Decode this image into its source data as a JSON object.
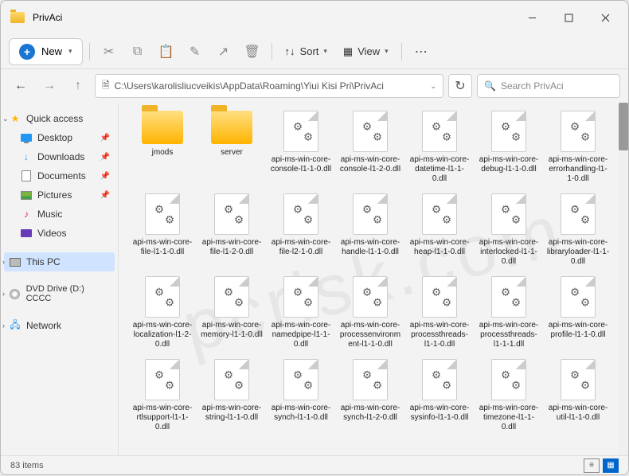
{
  "title": "PrivAci",
  "toolbar": {
    "new": "New",
    "sort": "Sort",
    "view": "View"
  },
  "address": "C:\\Users\\karolisliucveikis\\AppData\\Roaming\\Yiui Kisi Pri\\PrivAci",
  "search_placeholder": "Search PrivAci",
  "sidebar": {
    "quick": "Quick access",
    "desktop": "Desktop",
    "downloads": "Downloads",
    "documents": "Documents",
    "pictures": "Pictures",
    "music": "Music",
    "videos": "Videos",
    "thispc": "This PC",
    "dvd": "DVD Drive (D:) CCCC",
    "network": "Network"
  },
  "folders": [
    "jmods",
    "server"
  ],
  "files": [
    "api-ms-win-core-console-l1-1-0.dll",
    "api-ms-win-core-console-l1-2-0.dll",
    "api-ms-win-core-datetime-l1-1-0.dll",
    "api-ms-win-core-debug-l1-1-0.dll",
    "api-ms-win-core-errorhandling-l1-1-0.dll",
    "api-ms-win-core-file-l1-1-0.dll",
    "api-ms-win-core-file-l1-2-0.dll",
    "api-ms-win-core-file-l2-1-0.dll",
    "api-ms-win-core-handle-l1-1-0.dll",
    "api-ms-win-core-heap-l1-1-0.dll",
    "api-ms-win-core-interlocked-l1-1-0.dll",
    "api-ms-win-core-libraryloader-l1-1-0.dll",
    "api-ms-win-core-localization-l1-2-0.dll",
    "api-ms-win-core-memory-l1-1-0.dll",
    "api-ms-win-core-namedpipe-l1-1-0.dll",
    "api-ms-win-core-processenvironment-l1-1-0.dll",
    "api-ms-win-core-processthreads-l1-1-0.dll",
    "api-ms-win-core-processthreads-l1-1-1.dll",
    "api-ms-win-core-profile-l1-1-0.dll",
    "api-ms-win-core-rtlsupport-l1-1-0.dll",
    "api-ms-win-core-string-l1-1-0.dll",
    "api-ms-win-core-synch-l1-1-0.dll",
    "api-ms-win-core-synch-l1-2-0.dll",
    "api-ms-win-core-sysinfo-l1-1-0.dll",
    "api-ms-win-core-timezone-l1-1-0.dll",
    "api-ms-win-core-util-l1-1-0.dll"
  ],
  "status": "83 items"
}
